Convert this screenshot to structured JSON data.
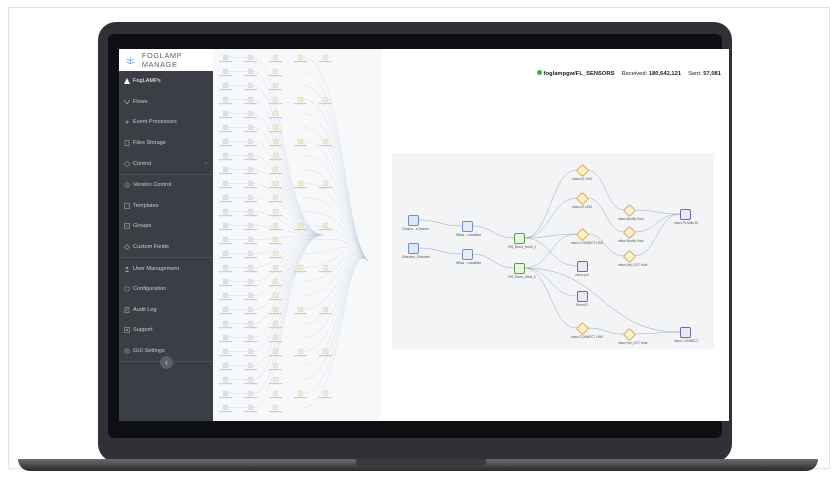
{
  "app": {
    "name": "FOGLAMP MANAGE"
  },
  "sidebar": {
    "items": [
      {
        "label": "FogLAMPs"
      },
      {
        "label": "Flows"
      },
      {
        "label": "Event Processors"
      },
      {
        "label": "Files Storage"
      },
      {
        "label": "Control"
      },
      {
        "label": "Version Control"
      },
      {
        "label": "Templates"
      },
      {
        "label": "Groups"
      },
      {
        "label": "Custom Fields"
      },
      {
        "label": "User Management"
      },
      {
        "label": "Configuration"
      },
      {
        "label": "Audit Log"
      },
      {
        "label": "Support"
      },
      {
        "label": "GUI Settings"
      }
    ],
    "collapse_icon": "chevron-left-icon"
  },
  "header": {
    "instance": "foglampgw/FL_SENSORS",
    "received_label": "Received:",
    "received_value": "180,642,121",
    "sent_label": "Sent:",
    "sent_value": "57,081",
    "status_color": "#2eb24b"
  },
  "flow": {
    "nodes": [
      {
        "label": "Cleaner - sCleaner"
      },
      {
        "label": "Dissolver_Dissolver"
      },
      {
        "label": "MBus - n.stabilize"
      },
      {
        "label": "MBus - n.stabilize"
      },
      {
        "label": "VW_Blood_North_2"
      },
      {
        "label": "VW_Blood_West_4"
      },
      {
        "label": "mbus AT UNS"
      },
      {
        "label": "mbus Modify Host"
      },
      {
        "label": "mbus AT UNS"
      },
      {
        "label": "mbus Modify Host"
      },
      {
        "label": "mbus CONNECT UNS"
      },
      {
        "label": "mbus Hst_GCT Host"
      },
      {
        "label": "mbus Ps Mish AT"
      },
      {
        "label": "mbus pul"
      },
      {
        "label": "Rmm AT"
      },
      {
        "label": "mbus CONNECT UNS"
      },
      {
        "label": "mbus Hst_GCT Host"
      },
      {
        "label": "mbus CONNECT"
      }
    ]
  }
}
